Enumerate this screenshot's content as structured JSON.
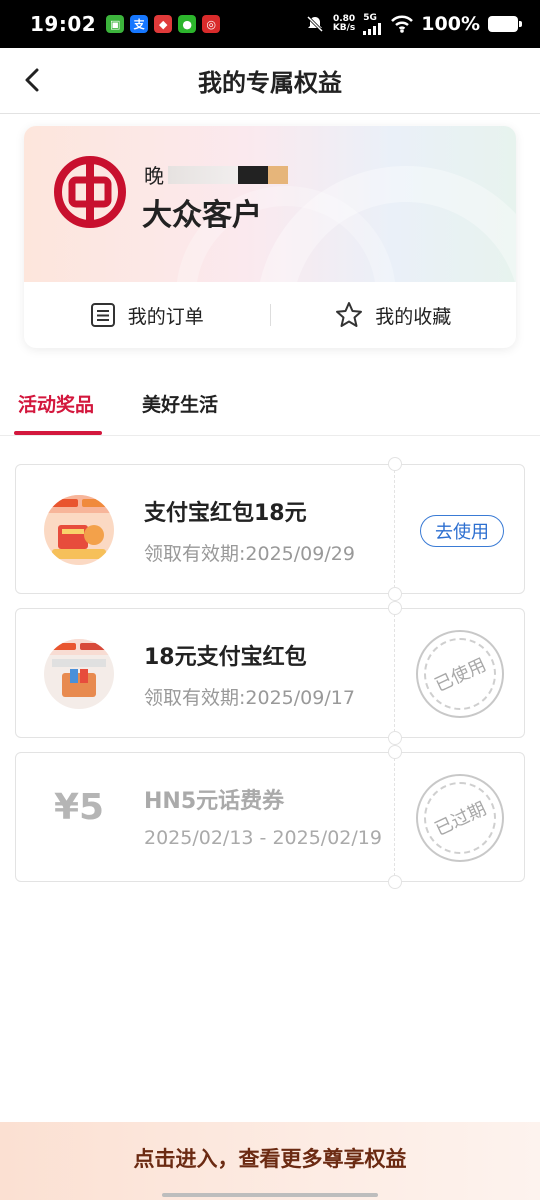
{
  "status_bar": {
    "time": "19:02",
    "net_speed_value": "0.80",
    "net_speed_unit": "KB/s",
    "network": "5G",
    "battery": "100%",
    "app_icons": [
      "wechat-pay-icon",
      "alipay-icon",
      "app-icon",
      "wechat-icon",
      "app-icon"
    ]
  },
  "header": {
    "title": "我的专属权益"
  },
  "profile": {
    "name_visible": "晚",
    "level": "大众客户",
    "actions": [
      {
        "label": "我的订单",
        "icon": "order-list-icon"
      },
      {
        "label": "我的收藏",
        "icon": "star-icon"
      }
    ]
  },
  "tabs": [
    {
      "label": "活动奖品",
      "active": true
    },
    {
      "label": "美好生活",
      "active": false
    }
  ],
  "coupons": [
    {
      "title": "支付宝红包18元",
      "date": "领取有效期:2025/09/29",
      "action": "去使用",
      "state": "available"
    },
    {
      "title": "18元支付宝红包",
      "date": "领取有效期:2025/09/17",
      "stamp": "已使用",
      "state": "used"
    },
    {
      "title": "HN5元话费券",
      "value": "¥5",
      "date": "2025/02/13 - 2025/02/19",
      "stamp": "已过期",
      "state": "expired"
    }
  ],
  "bottom_banner": {
    "text": "点击进入，查看更多尊享权益"
  },
  "colors": {
    "accent": "#d3173d",
    "link_blue": "#2d6fd0",
    "boc_red": "#c8102e"
  }
}
